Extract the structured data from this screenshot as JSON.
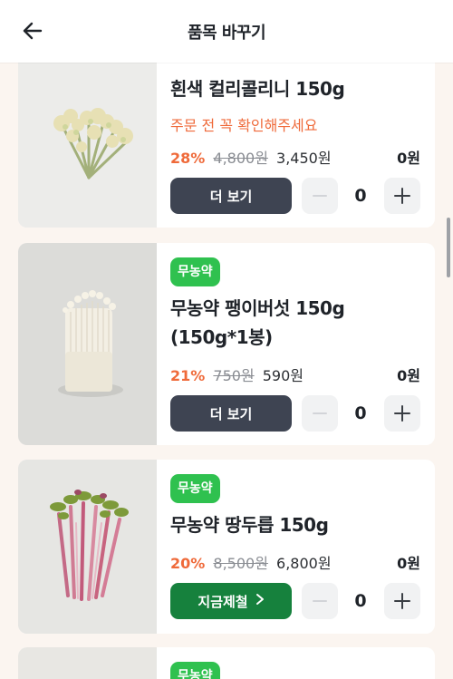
{
  "header": {
    "title": "품목 바꾸기",
    "back_icon": "arrow-left-icon"
  },
  "products": [
    {
      "name": "흰색 컬리콜리니 150g",
      "notice": "주문 전 꼭 확인해주세요",
      "discount": "28%",
      "original_price": "4,800원",
      "price": "3,450원",
      "total": "0원",
      "button_label": "더 보기",
      "quantity": "0"
    },
    {
      "badge": "무농약",
      "name_line1": "무농약 팽이버섯 150g",
      "name_line2": "(150g*1봉)",
      "discount": "21%",
      "original_price": "750원",
      "price": "590원",
      "total": "0원",
      "button_label": "더 보기",
      "quantity": "0"
    },
    {
      "badge": "무농약",
      "name": "무농약 땅두릅 150g",
      "discount": "20%",
      "original_price": "8,500원",
      "price": "6,800원",
      "total": "0원",
      "button_label": "지금제철",
      "quantity": "0"
    },
    {
      "badge": "무농약"
    }
  ],
  "colors": {
    "accent_discount": "#ef6a3a",
    "badge_green": "#2fc14f",
    "button_dark": "#3e4452",
    "button_season": "#16813d",
    "background": "#fbf5f0"
  }
}
